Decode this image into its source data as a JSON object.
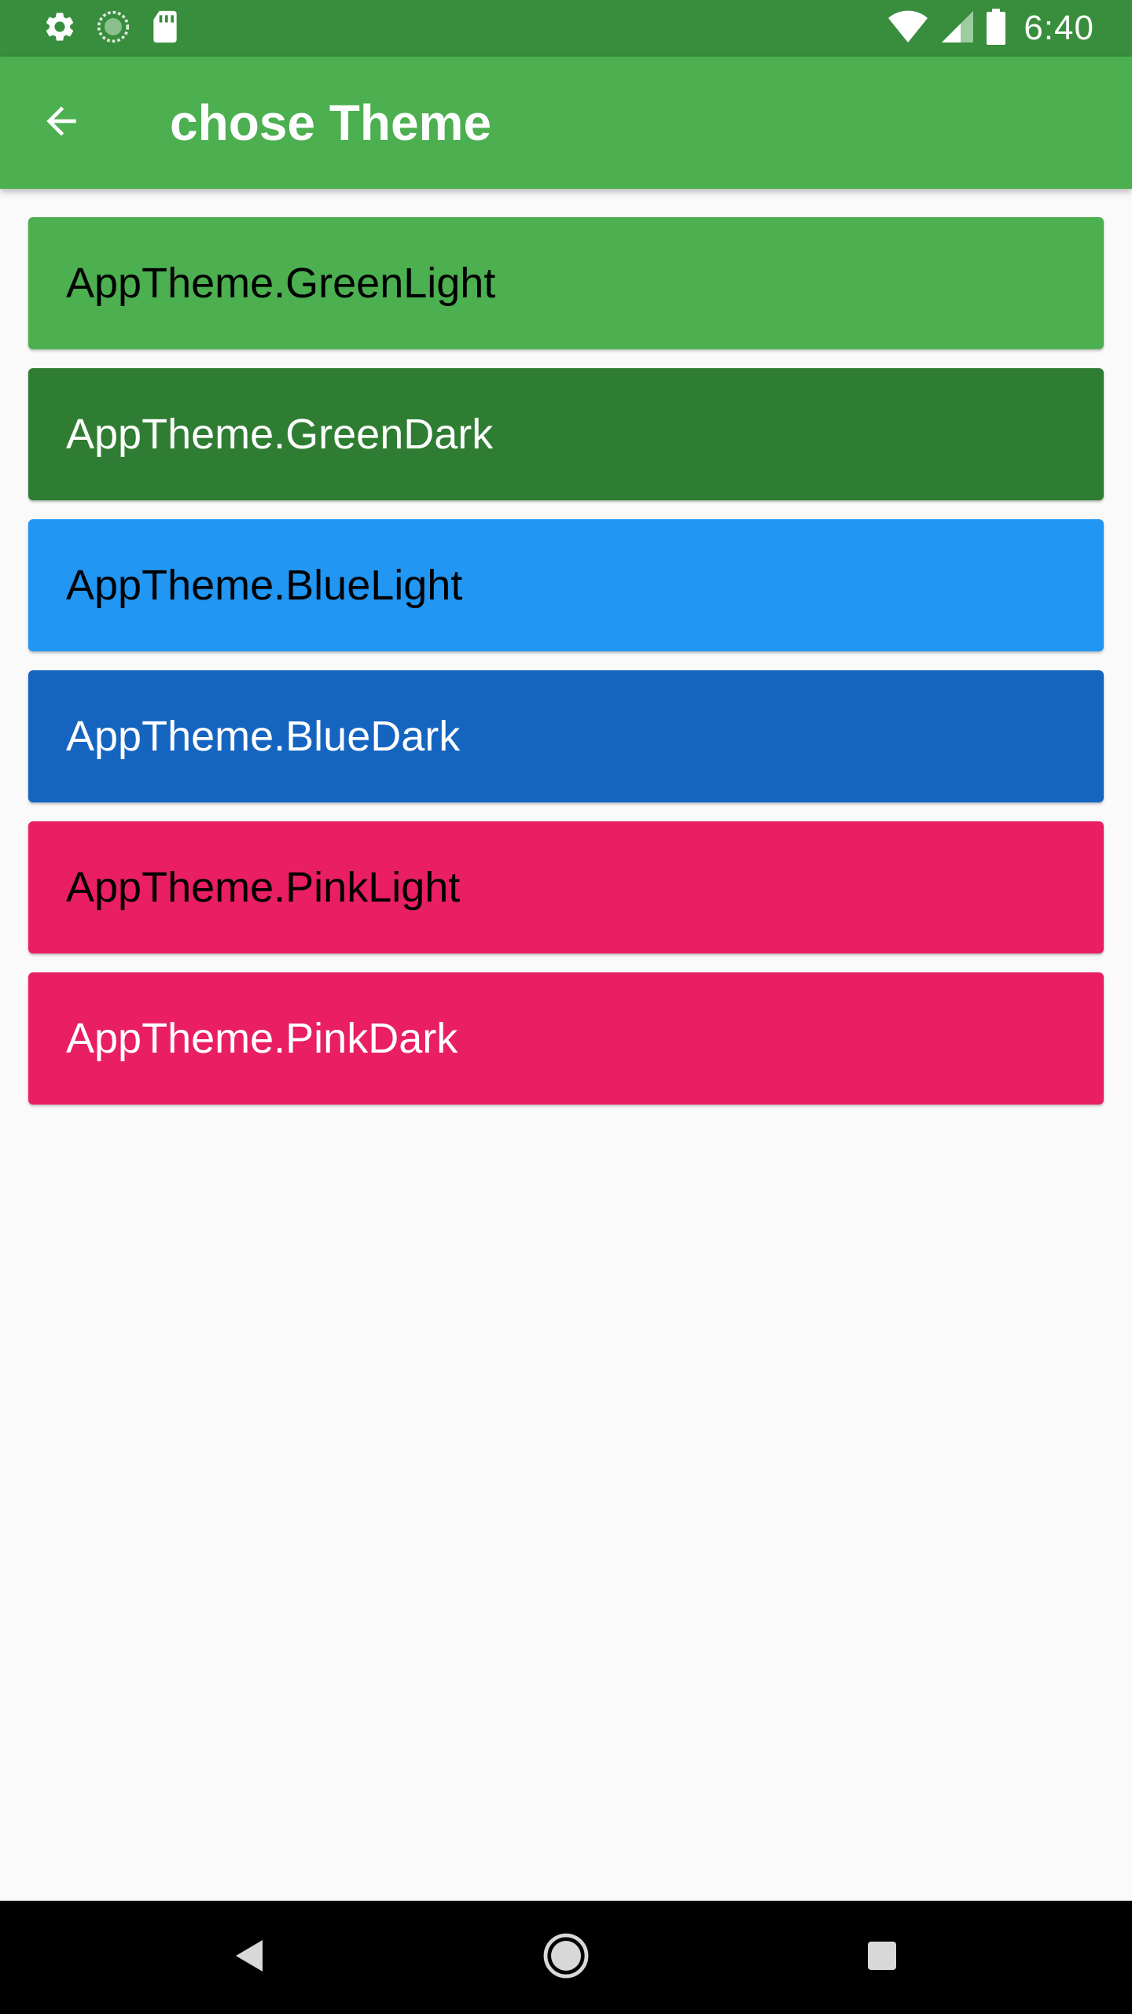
{
  "status_bar": {
    "time": "6:40",
    "icons": [
      "gear-icon",
      "sync-icon",
      "sd-card-icon",
      "wifi-icon",
      "signal-icon",
      "battery-icon"
    ]
  },
  "app_bar": {
    "title": "chose Theme",
    "back_icon": "arrow-back-icon"
  },
  "themes": [
    {
      "label": "AppTheme.GreenLight",
      "bg": "#4caf50",
      "text": "#000000"
    },
    {
      "label": "AppTheme.GreenDark",
      "bg": "#2e7d32",
      "text": "#ffffff"
    },
    {
      "label": "AppTheme.BlueLight",
      "bg": "#2196f3",
      "text": "#000000"
    },
    {
      "label": "AppTheme.BlueDark",
      "bg": "#1565c0",
      "text": "#ffffff"
    },
    {
      "label": "AppTheme.PinkLight",
      "bg": "#e91e63",
      "text": "#000000"
    },
    {
      "label": "AppTheme.PinkDark",
      "bg": "#e91e63",
      "text": "#ffffff"
    }
  ],
  "nav_bar": {
    "icons": [
      "back-triangle-icon",
      "home-circle-icon",
      "recents-square-icon"
    ]
  },
  "colors": {
    "status_bar": "#388e3c",
    "app_bar": "#4caf50",
    "background": "#fafafa"
  }
}
